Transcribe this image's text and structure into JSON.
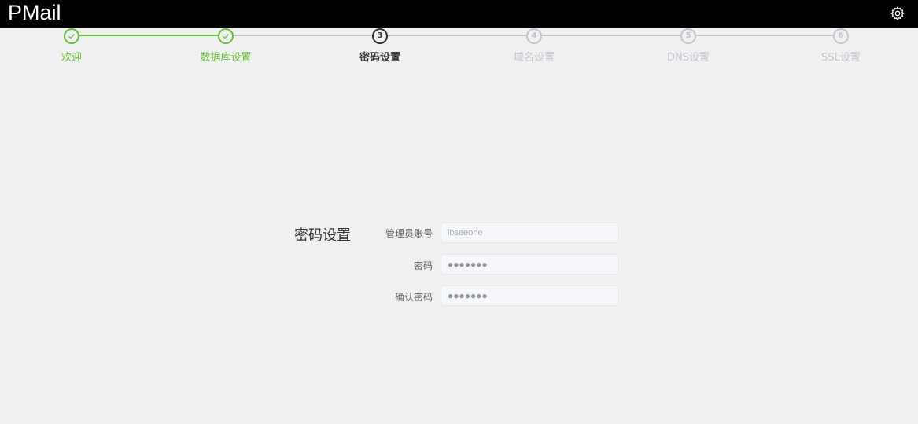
{
  "header": {
    "app_title": "PMail",
    "settings_icon": "gear-icon"
  },
  "steps": [
    {
      "label": "欢迎",
      "number": "1",
      "status": "done"
    },
    {
      "label": "数据库设置",
      "number": "2",
      "status": "done"
    },
    {
      "label": "密码设置",
      "number": "3",
      "status": "active"
    },
    {
      "label": "域名设置",
      "number": "4",
      "status": "pending"
    },
    {
      "label": "DNS设置",
      "number": "5",
      "status": "pending"
    },
    {
      "label": "SSL设置",
      "number": "6",
      "status": "pending"
    }
  ],
  "colors": {
    "done": "#67c23a",
    "active": "#303133",
    "pending": "#c0c4cc",
    "topbar": "#000000",
    "page_bg": "#f0f0f0"
  },
  "form": {
    "title": "密码设置",
    "admin_account_label": "管理员账号",
    "admin_account_value": "ioseeone",
    "password_label": "密码",
    "password_value": "●●●●●●●",
    "confirm_password_label": "确认密码",
    "confirm_password_value": "●●●●●●●"
  }
}
